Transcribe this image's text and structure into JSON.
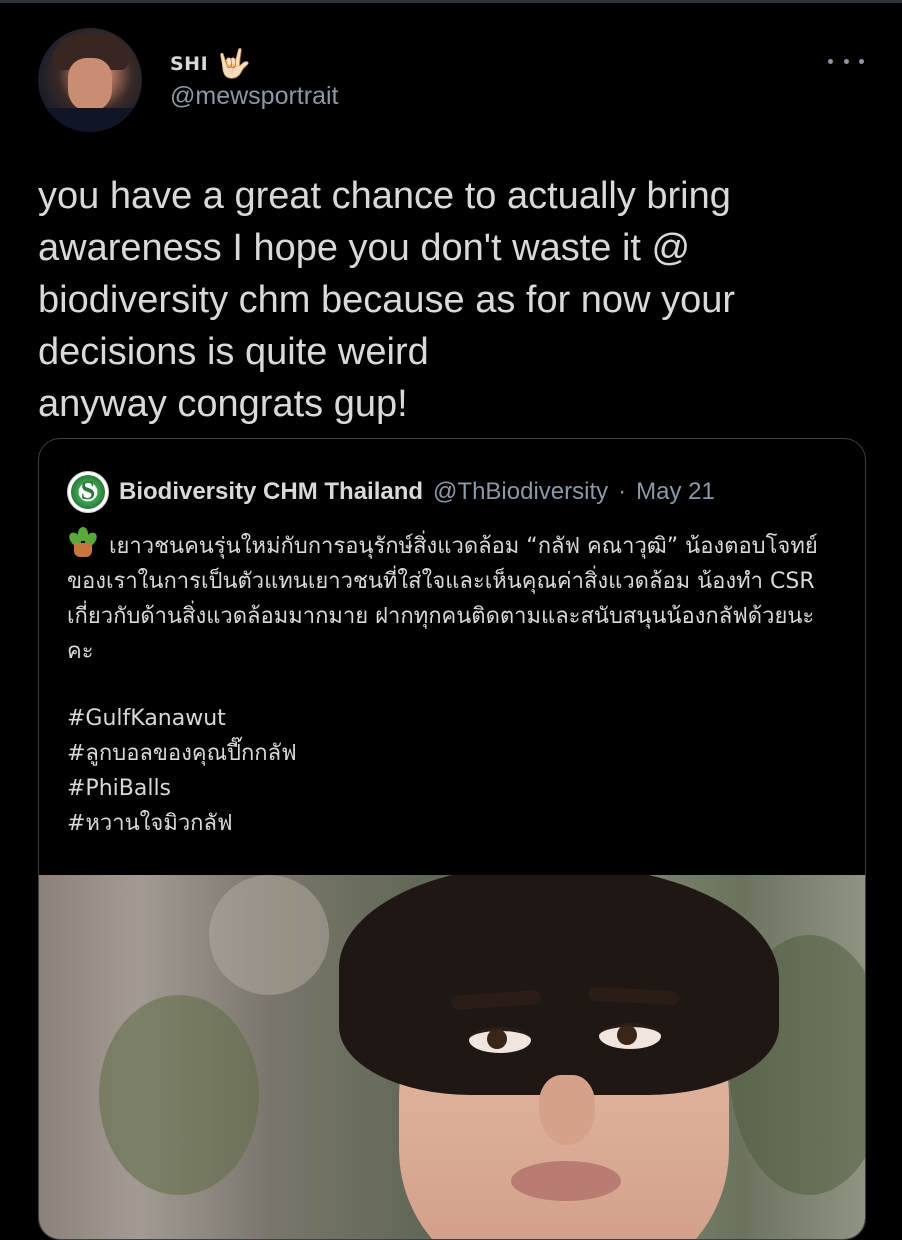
{
  "author": {
    "display_name": "SHI",
    "name_emoji": "🤟🏻",
    "handle": "@mewsportrait"
  },
  "menu": {
    "more_icon": "more-horizontal-icon"
  },
  "tweet": {
    "text": "you have a great chance to actually bring awareness I hope you don't waste it @ biodiversity chm because as for now your decisions is quite weird\nanyway congrats gup!"
  },
  "quoted_tweet": {
    "author_name": "Biodiversity CHM Thailand",
    "author_handle": "@ThBiodiversity",
    "separator": "·",
    "date": "May 21",
    "avatar_icon": "biodiversity-logo-icon",
    "body_emoji_icon": "potted-plant-icon",
    "body": "เยาวชนคนรุ่นใหม่กับการอนุรักษ์สิ่งแวดล้อม “กลัฟ คณาวุฒิ” น้องตอบโจทย์ของเราในการเป็นตัวแทนเยาวชนที่ใส่ใจและเห็นคุณค่าสิ่งแวดล้อม น้องทำ CSR เกี่ยวกับด้านสิ่งแวดล้อมมากมาย ฝากทุกคนติดตามและสนับสนุนน้องกลัฟด้วยนะคะ",
    "hashtags": [
      "#GulfKanawut",
      "#ลูกบอลของคุณปี๊กกลัฟ",
      "#PhiBalls",
      "#หวานใจมิวกลัฟ"
    ]
  },
  "colors": {
    "background": "#000000",
    "text_primary": "#d9d9d9",
    "text_secondary": "#8b98a5",
    "border": "#3d4247"
  }
}
